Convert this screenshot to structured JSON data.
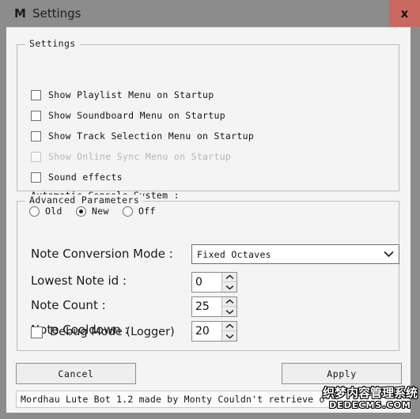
{
  "window": {
    "title": "Settings",
    "logo_glyph": "M",
    "close_label": "x",
    "titlebar_color": "#8c8c8c",
    "close_button_color": "#c9695f",
    "client_background": "#f4f4f4"
  },
  "settings_group": {
    "title": "Settings",
    "checkboxes": [
      {
        "label": "Show Playlist Menu on Startup",
        "checked": false,
        "disabled": false
      },
      {
        "label": "Show Soundboard Menu on Startup",
        "checked": false,
        "disabled": false
      },
      {
        "label": "Show Track Selection Menu on Startup",
        "checked": false,
        "disabled": false
      },
      {
        "label": "Show Online Sync Menu on Startup",
        "checked": false,
        "disabled": true
      },
      {
        "label": "Sound effects",
        "checked": false,
        "disabled": false
      }
    ],
    "radio_caption": "Automatic Console System :",
    "radios": [
      {
        "label": "Old",
        "checked": false
      },
      {
        "label": "New",
        "checked": true
      },
      {
        "label": "Off",
        "checked": false
      }
    ]
  },
  "advanced_group": {
    "title": "Advanced Parameters",
    "note_conversion_mode": {
      "label": "Note Conversion Mode :",
      "value": "Fixed Octaves"
    },
    "lowest_note_id": {
      "label": "Lowest Note id :",
      "value": "0"
    },
    "note_count": {
      "label": "Note Count :",
      "value": "25"
    },
    "note_cooldown": {
      "label": "Note Cooldown :",
      "value": "20"
    },
    "debug_mode": {
      "label": "Debug Mode (Logger)",
      "checked": false
    }
  },
  "buttons": {
    "cancel": "Cancel",
    "apply": "Apply"
  },
  "statusbar": {
    "text": "Mordhau Lute Bot 1.2 made by Monty  Couldn't retrieve o"
  },
  "watermark": {
    "cjk": "织梦内容管理系统",
    "latin": "DEDECMS.COM"
  }
}
